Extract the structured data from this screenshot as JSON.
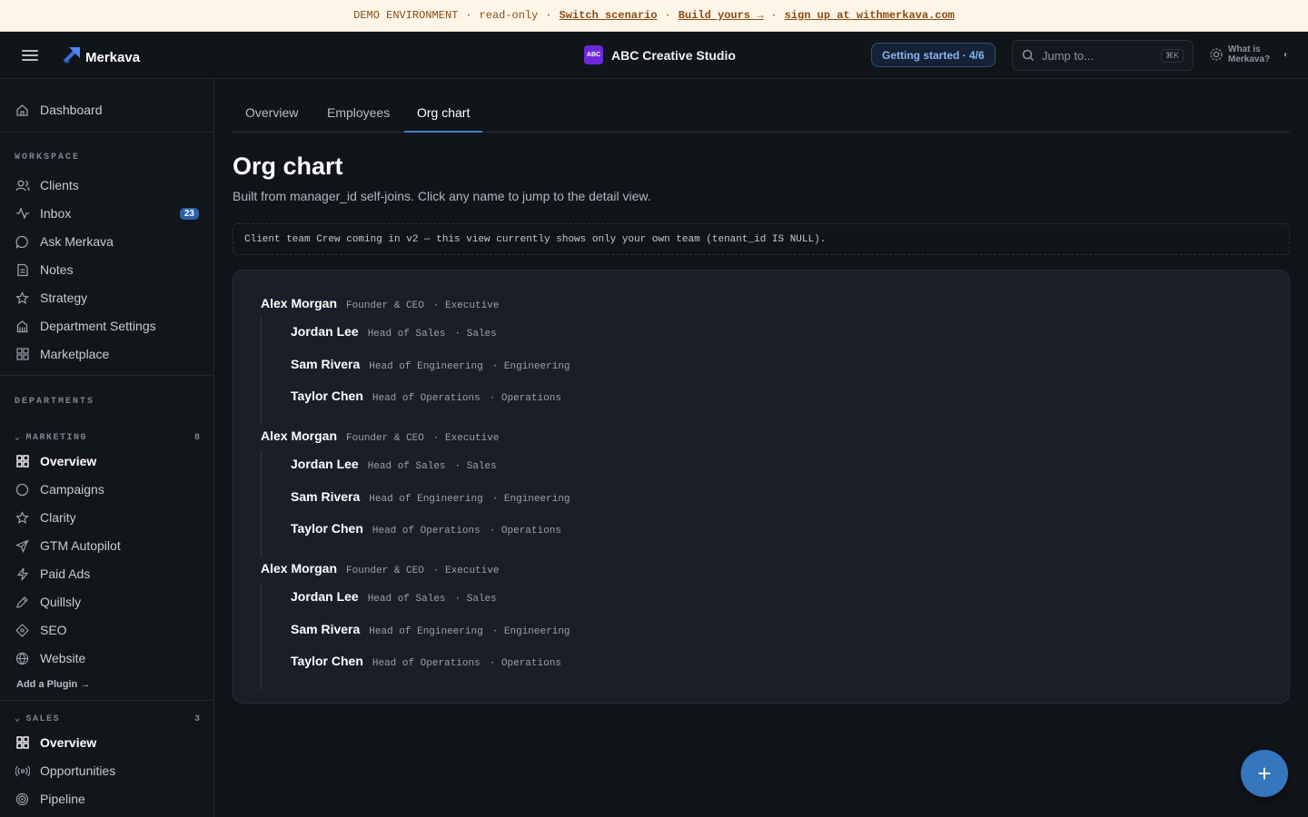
{
  "banner": {
    "env": "DEMO ENVIRONMENT",
    "mode": "read-only",
    "switch": "Switch scenario",
    "build": "Build yours →",
    "signup": "sign up at withmerkava.com",
    "separator": "·"
  },
  "header": {
    "logo": "Merkava",
    "org_badge": "ABC",
    "org_name": "ABC Creative Studio",
    "getting_started": "Getting started · 4/6",
    "search_placeholder": "Jump to...",
    "search_shortcut": "⌘K",
    "what_is": "What is Merkava?",
    "what_glyph": "◐"
  },
  "sidebar": {
    "dashboard": "Dashboard",
    "workspace_label": "WORKSPACE",
    "workspace": [
      {
        "label": "Clients",
        "icon": "users-icon"
      },
      {
        "label": "Inbox",
        "icon": "activity-icon",
        "badge": "23"
      },
      {
        "label": "Ask Merkava",
        "icon": "chat-icon"
      },
      {
        "label": "Notes",
        "icon": "note-icon"
      },
      {
        "label": "Strategy",
        "icon": "star-icon"
      },
      {
        "label": "Department Settings",
        "icon": "building-icon"
      },
      {
        "label": "Marketplace",
        "icon": "grid-icon"
      }
    ],
    "departments_label": "DEPARTMENTS",
    "marketing": {
      "label": "MARKETING",
      "count": "8",
      "items": [
        "Overview",
        "Campaigns",
        "Clarity",
        "GTM Autopilot",
        "Paid Ads",
        "Quillsly",
        "SEO",
        "Website"
      ]
    },
    "add_plugin": "Add a Plugin →",
    "sales": {
      "label": "SALES",
      "count": "3",
      "items": [
        "Overview",
        "Opportunities",
        "Pipeline"
      ]
    }
  },
  "tabs": [
    "Overview",
    "Employees",
    "Org chart"
  ],
  "active_tab": "Org chart",
  "page": {
    "title": "Org chart",
    "subtitle": "Built from manager_id self-joins. Click any name to jump to the detail view.",
    "notice": "Client team Crew coming in v2 — this view currently shows only your own team (tenant_id IS NULL)."
  },
  "org_tree": [
    {
      "name": "Alex Morgan",
      "title": "Founder & CEO",
      "dept": "· Executive",
      "reports": [
        {
          "name": "Jordan Lee",
          "title": "Head of Sales",
          "dept": "· Sales"
        },
        {
          "name": "Sam Rivera",
          "title": "Head of Engineering",
          "dept": "· Engineering"
        },
        {
          "name": "Taylor Chen",
          "title": "Head of Operations",
          "dept": "· Operations"
        }
      ]
    },
    {
      "name": "Alex Morgan",
      "title": "Founder & CEO",
      "dept": "· Executive",
      "reports": [
        {
          "name": "Jordan Lee",
          "title": "Head of Sales",
          "dept": "· Sales"
        },
        {
          "name": "Sam Rivera",
          "title": "Head of Engineering",
          "dept": "· Engineering"
        },
        {
          "name": "Taylor Chen",
          "title": "Head of Operations",
          "dept": "· Operations"
        }
      ]
    },
    {
      "name": "Alex Morgan",
      "title": "Founder & CEO",
      "dept": "· Executive",
      "reports": [
        {
          "name": "Jordan Lee",
          "title": "Head of Sales",
          "dept": "· Sales"
        },
        {
          "name": "Sam Rivera",
          "title": "Head of Engineering",
          "dept": "· Engineering"
        },
        {
          "name": "Taylor Chen",
          "title": "Head of Operations",
          "dept": "· Operations"
        }
      ]
    }
  ],
  "fab": "+",
  "colors": {
    "accent": "#3576bd",
    "banner_bg": "#fdf5e7",
    "banner_text": "#8a4b12",
    "badge": "#2b62a8",
    "org_badge": "#6d28d9"
  }
}
